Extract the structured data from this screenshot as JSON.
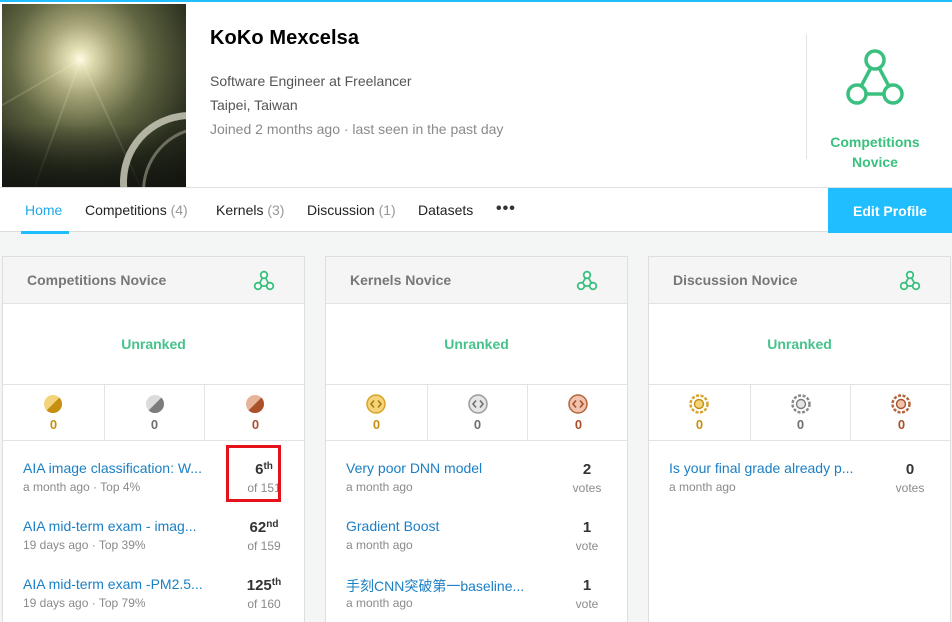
{
  "profile": {
    "name": "KoKo Mexcelsa",
    "job": "Software Engineer at Freelancer",
    "location": "Taipei, Taiwan",
    "joined": "Joined 2 months ago · last seen in the past day",
    "tier_line1": "Competitions",
    "tier_line2": "Novice",
    "tier_icon": "novice-tier-icon"
  },
  "tabs": [
    {
      "label": "Home",
      "count": ""
    },
    {
      "label": "Competitions",
      "count": "(4)"
    },
    {
      "label": "Kernels",
      "count": "(3)"
    },
    {
      "label": "Discussion",
      "count": "(1)"
    },
    {
      "label": "Datasets",
      "count": ""
    }
  ],
  "more_label": "•••",
  "edit_profile": "Edit Profile",
  "colors": {
    "accent": "#20beff",
    "tier_green": "#3ac07e",
    "link": "#1a7fc4",
    "gold": "#d9a22a",
    "silver": "#8a8a8a",
    "bronze": "#b5653b"
  },
  "cards": [
    {
      "title": "Competitions Novice",
      "rank": "Unranked",
      "medal_style": "competition",
      "medals": {
        "gold": "0",
        "silver": "0",
        "bronze": "0"
      },
      "items": [
        {
          "title": "AIA image classification: W...",
          "sub": "a month ago · Top 4%",
          "rank": "6",
          "suffix": "th",
          "of": "of 151"
        },
        {
          "title": "AIA mid-term exam - imag...",
          "sub": "19 days ago · Top 39%",
          "rank": "62",
          "suffix": "nd",
          "of": "of 159"
        },
        {
          "title": "AIA mid-term exam -PM2.5...",
          "sub": "19 days ago · Top 79%",
          "rank": "125",
          "suffix": "th",
          "of": "of 160"
        }
      ]
    },
    {
      "title": "Kernels Novice",
      "rank": "Unranked",
      "medal_style": "kernel",
      "medals": {
        "gold": "0",
        "silver": "0",
        "bronze": "0"
      },
      "items": [
        {
          "title": "Very poor DNN model",
          "sub": "a month ago",
          "votes": "2",
          "vote_label": "votes"
        },
        {
          "title": "Gradient Boost",
          "sub": "a month ago",
          "votes": "1",
          "vote_label": "vote"
        },
        {
          "title": "手刻CNN突破第一baseline...",
          "sub": "a month ago",
          "votes": "1",
          "vote_label": "vote"
        }
      ]
    },
    {
      "title": "Discussion Novice",
      "rank": "Unranked",
      "medal_style": "discussion",
      "medals": {
        "gold": "0",
        "silver": "0",
        "bronze": "0"
      },
      "items": [
        {
          "title": "Is your final grade already p...",
          "sub": "a month ago",
          "votes": "0",
          "vote_label": "votes"
        }
      ]
    }
  ]
}
